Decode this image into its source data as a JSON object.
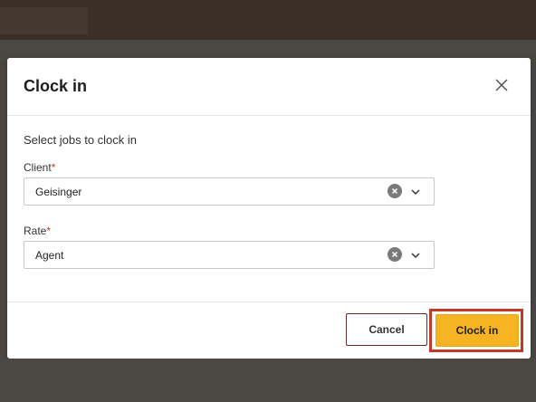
{
  "modal": {
    "title": "Clock in",
    "subtitle": "Select jobs to clock in",
    "close_icon": "close-icon"
  },
  "fields": {
    "client": {
      "label": "Client",
      "required_marker": "*",
      "value": "Geisinger"
    },
    "rate": {
      "label": "Rate",
      "required_marker": "*",
      "value": "Agent"
    }
  },
  "footer": {
    "cancel_label": "Cancel",
    "clockin_label": "Clock in"
  },
  "colors": {
    "primary": "#f7b422",
    "highlight_outline": "#c0392b",
    "required": "#c0392b"
  }
}
